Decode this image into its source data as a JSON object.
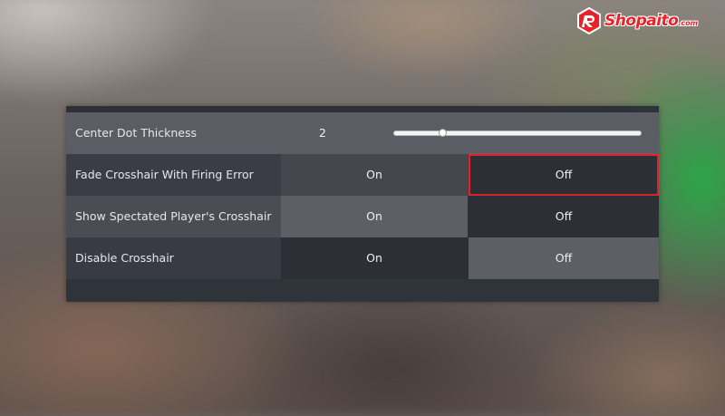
{
  "branding": {
    "logo_text": "Shopaito",
    "logo_suffix": ".com",
    "logo_color": "#e8222a"
  },
  "settings": {
    "rows": [
      {
        "label": "Center Dot Thickness",
        "type": "slider",
        "value": "2",
        "slider_fraction": 0.2
      },
      {
        "label": "Fade Crosshair With Firing Error",
        "type": "toggle",
        "options": [
          "On",
          "Off"
        ],
        "selected": "Off",
        "highlighted": "Off"
      },
      {
        "label": "Show Spectated Player's Crosshair",
        "type": "toggle",
        "options": [
          "On",
          "Off"
        ],
        "selected": "Off"
      },
      {
        "label": "Disable Crosshair",
        "type": "toggle",
        "options": [
          "On",
          "Off"
        ],
        "selected": "Off"
      }
    ]
  },
  "colors": {
    "highlight_border": "#d5262a",
    "panel_bg": "#2a2e36",
    "text": "#f1f1f1"
  }
}
